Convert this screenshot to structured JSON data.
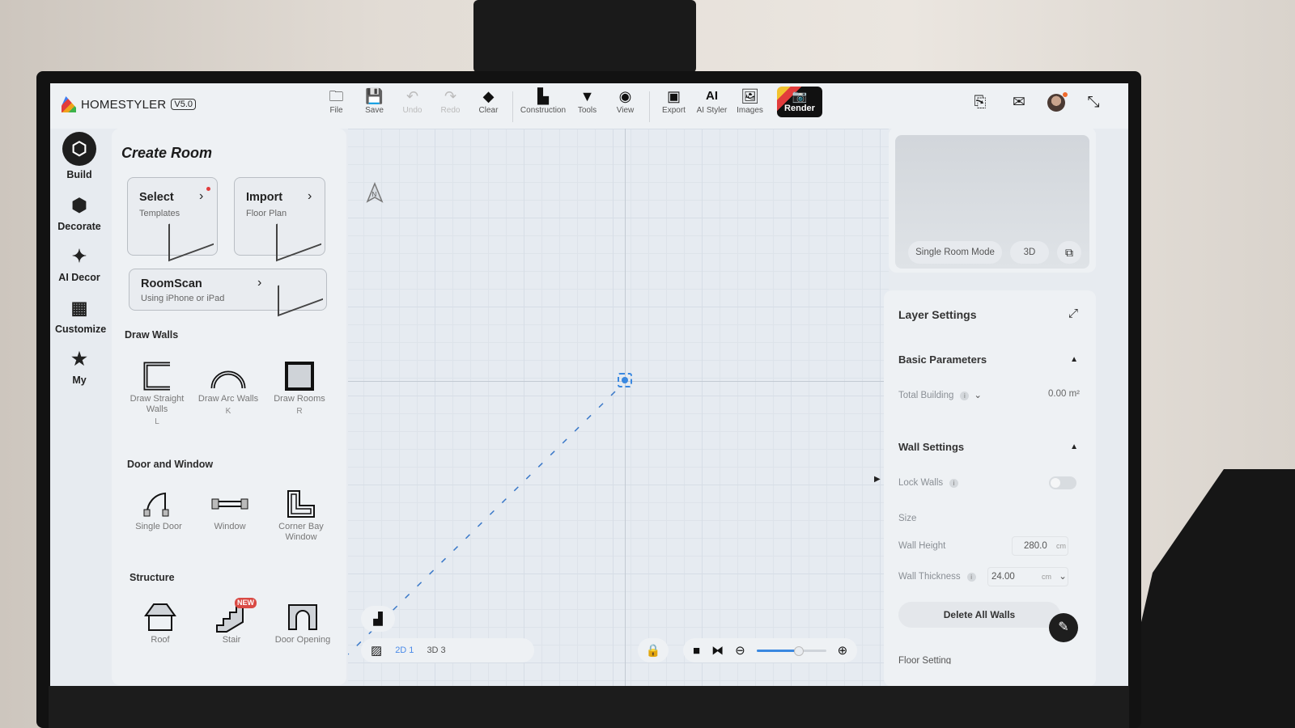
{
  "app": {
    "name": "HOMESTYLER",
    "version": "V5.0"
  },
  "toolbar": [
    {
      "label": "File",
      "icon": "folder-icon",
      "glyph": "🗀",
      "enabled": true
    },
    {
      "label": "Save",
      "icon": "save-icon",
      "glyph": "💾",
      "enabled": true
    },
    {
      "label": "Undo",
      "icon": "undo-icon",
      "glyph": "↶",
      "enabled": false
    },
    {
      "label": "Redo",
      "icon": "redo-icon",
      "glyph": "↷",
      "enabled": false
    },
    {
      "label": "Clear",
      "icon": "eraser-icon",
      "glyph": "◆",
      "enabled": true
    },
    {
      "label": "Construction",
      "icon": "construction-icon",
      "glyph": "▙",
      "enabled": true
    },
    {
      "label": "Tools",
      "icon": "tools-icon",
      "glyph": "▼",
      "enabled": true
    },
    {
      "label": "View",
      "icon": "eye-icon",
      "glyph": "◉",
      "enabled": true
    },
    {
      "label": "Export",
      "icon": "export-icon",
      "glyph": "▣",
      "enabled": true
    },
    {
      "label": "AI Styler",
      "icon": "ai-styler-icon",
      "glyph": "AI",
      "enabled": true
    },
    {
      "label": "Images",
      "icon": "images-icon",
      "glyph": "🖼",
      "enabled": true
    }
  ],
  "render_button": {
    "label": "Render",
    "glyph": "📷"
  },
  "header_right": {
    "search_doc": "⎘",
    "mail": "✉",
    "fullscreen": "⤡"
  },
  "nav": [
    {
      "label": "Build",
      "glyph": "⬡",
      "active": true
    },
    {
      "label": "Decorate",
      "glyph": "⬢",
      "active": false
    },
    {
      "label": "AI Decor",
      "glyph": "✦",
      "active": false
    },
    {
      "label": "Customize",
      "glyph": "▦",
      "active": false
    },
    {
      "label": "My",
      "glyph": "★",
      "active": false
    }
  ],
  "panel": {
    "title": "Create Room",
    "cards": [
      {
        "title": "Select",
        "subtitle": "Templates"
      },
      {
        "title": "Import",
        "subtitle": "Floor Plan"
      },
      {
        "title": "RoomScan",
        "subtitle": "Using iPhone or iPad"
      }
    ],
    "sections": {
      "draw_walls": "Draw Walls",
      "door_window": "Door and Window",
      "structure": "Structure"
    },
    "draw_walls": [
      {
        "label": "Draw Straight Walls",
        "key": "L"
      },
      {
        "label": "Draw Arc Walls",
        "key": "K"
      },
      {
        "label": "Draw Rooms",
        "key": "R"
      }
    ],
    "door_window": [
      {
        "label": "Single Door"
      },
      {
        "label": "Window"
      },
      {
        "label": "Corner Bay Window"
      }
    ],
    "structure": [
      {
        "label": "Roof"
      },
      {
        "label": "Stair",
        "badge": "NEW"
      },
      {
        "label": "Door Opening"
      }
    ]
  },
  "canvas": {
    "north_label": "N",
    "view_2d": "2D 1",
    "view_3d": "3D 3",
    "zoom_level_fraction": 0.6
  },
  "preview": {
    "mode_label": "Single Room Mode",
    "view_label": "3D"
  },
  "settings": {
    "title": "Layer Settings",
    "basic_title": "Basic Parameters",
    "total_building_label": "Total Building",
    "total_building_value": "0.00 m²",
    "wall_title": "Wall Settings",
    "lock_walls_label": "Lock Walls",
    "lock_walls_on": false,
    "size_label": "Size",
    "wall_height_label": "Wall Height",
    "wall_height_value": "280.0",
    "wall_height_unit": "cm",
    "wall_thickness_label": "Wall Thickness",
    "wall_thickness_value": "24.00",
    "wall_thickness_unit": "cm",
    "delete_label": "Delete All Walls",
    "next_section_partial": "Floor Setting"
  }
}
